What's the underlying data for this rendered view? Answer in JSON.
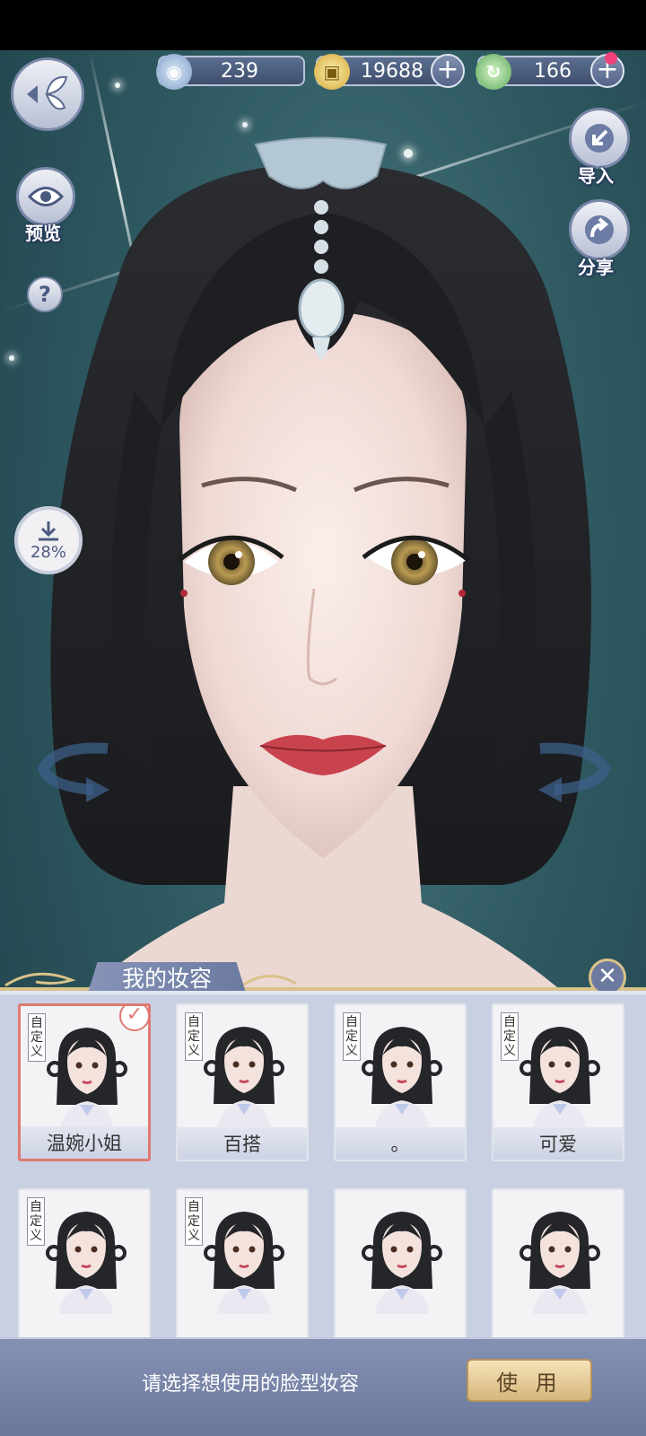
{
  "currencies": [
    {
      "name": "jade",
      "value": "239",
      "color": "#8fb0d8"
    },
    {
      "name": "coin",
      "value": "19688",
      "color": "#e5c55a"
    },
    {
      "name": "energy",
      "value": "166",
      "color": "#7ad07a"
    }
  ],
  "side": {
    "preview_label": "预览",
    "help_label": "?",
    "import_label": "导入",
    "share_label": "分享",
    "download_progress": "28%"
  },
  "panel": {
    "title": "我的妆容",
    "tag_text": "自定义",
    "cards": [
      {
        "name": "温婉小姐",
        "custom": true,
        "selected": true
      },
      {
        "name": "百搭",
        "custom": true,
        "selected": false
      },
      {
        "name": "。",
        "custom": true,
        "selected": false
      },
      {
        "name": "可爱",
        "custom": true,
        "selected": false
      },
      {
        "name": "",
        "custom": true,
        "selected": false
      },
      {
        "name": "",
        "custom": true,
        "selected": false
      },
      {
        "name": "",
        "custom": false,
        "selected": false
      },
      {
        "name": "",
        "custom": false,
        "selected": false
      }
    ]
  },
  "footer": {
    "hint": "请选择想使用的脸型妆容",
    "use_label": "使 用"
  },
  "icons": [
    "back-butterfly-icon",
    "eye-icon",
    "help-icon",
    "import-icon",
    "share-icon",
    "download-icon",
    "rotate-left-icon",
    "rotate-right-icon",
    "close-icon",
    "check-icon",
    "plus-icon"
  ]
}
